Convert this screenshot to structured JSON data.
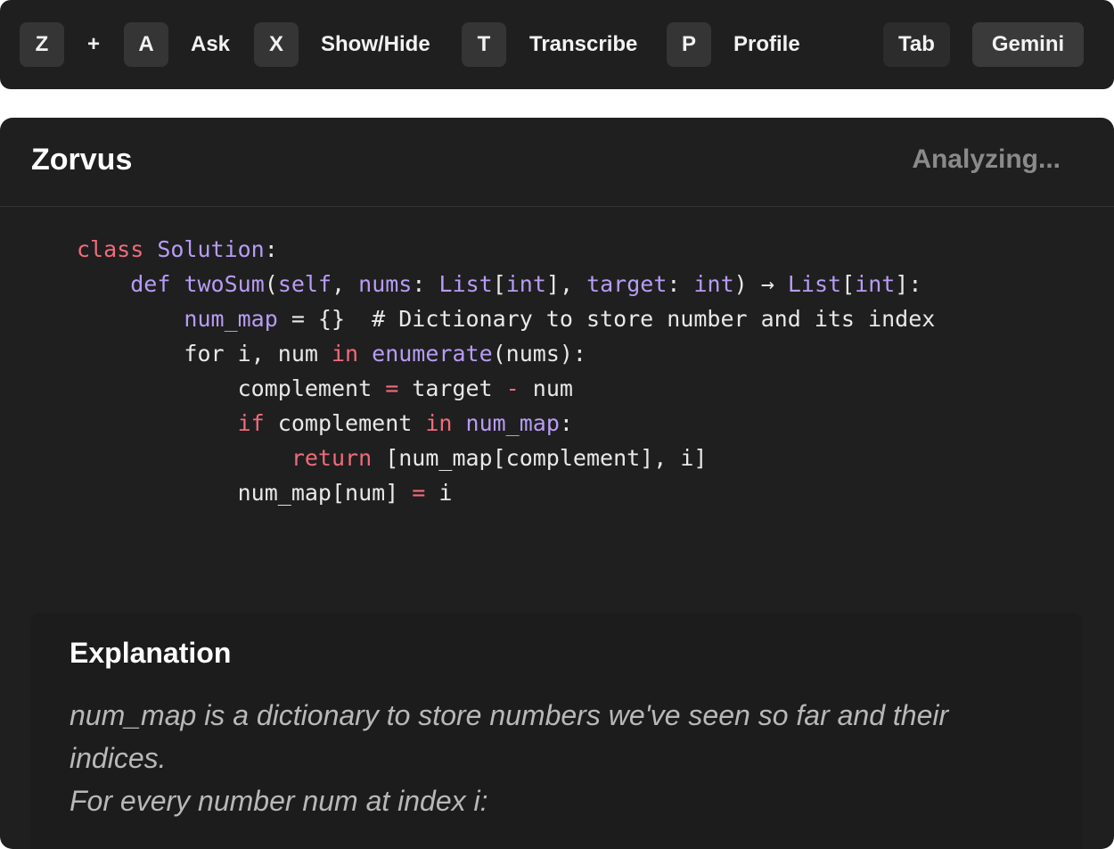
{
  "toolbar": {
    "keys": [
      {
        "key": "Z"
      },
      {
        "sep": "+"
      },
      {
        "key": "A",
        "label": "Ask"
      },
      {
        "key": "X",
        "label": "Show/Hide"
      },
      {
        "key": "T",
        "label": "Transcribe"
      },
      {
        "key": "P",
        "label": "Profile"
      }
    ],
    "z_key": "Z",
    "plus": "+",
    "ask_key": "A",
    "ask_label": "Ask",
    "showhide_key": "X",
    "showhide_label": "Show/Hide",
    "transcribe_key": "T",
    "transcribe_label": "Transcribe",
    "profile_key": "P",
    "profile_label": "Profile",
    "tab_label": "Tab",
    "model_label": "Gemini"
  },
  "panel": {
    "title": "Zorvus",
    "status": "Analyzing..."
  },
  "code": {
    "lines": [
      [
        [
          "k",
          "class"
        ],
        [
          "n",
          " "
        ],
        [
          "p",
          "Solution"
        ],
        [
          "n",
          ":"
        ]
      ],
      [
        [
          "n",
          "    "
        ],
        [
          "p",
          "def"
        ],
        [
          "n",
          " "
        ],
        [
          "p",
          "twoSum"
        ],
        [
          "n",
          "("
        ],
        [
          "p",
          "self"
        ],
        [
          "n",
          ", "
        ],
        [
          "p",
          "nums"
        ],
        [
          "n",
          ": "
        ],
        [
          "p",
          "List"
        ],
        [
          "n",
          "["
        ],
        [
          "p",
          "int"
        ],
        [
          "n",
          "], "
        ],
        [
          "p",
          "target"
        ],
        [
          "n",
          ": "
        ],
        [
          "p",
          "int"
        ],
        [
          "n",
          ") → "
        ],
        [
          "p",
          "List"
        ],
        [
          "n",
          "["
        ],
        [
          "p",
          "int"
        ],
        [
          "n",
          "]:"
        ]
      ],
      [
        [
          "n",
          "        "
        ],
        [
          "p",
          "num_map"
        ],
        [
          "n",
          " = {}  # Dictionary to store number and its index"
        ]
      ],
      [
        [
          "n",
          "        for i, num "
        ],
        [
          "k",
          "in"
        ],
        [
          "n",
          " "
        ],
        [
          "p",
          "enumerate"
        ],
        [
          "n",
          "(nums):"
        ]
      ],
      [
        [
          "n",
          "            complement "
        ],
        [
          "k",
          "="
        ],
        [
          "n",
          " target "
        ],
        [
          "k",
          "-"
        ],
        [
          "n",
          " num"
        ]
      ],
      [
        [
          "n",
          "            "
        ],
        [
          "k",
          "if"
        ],
        [
          "n",
          " complement "
        ],
        [
          "k",
          "in"
        ],
        [
          "n",
          " "
        ],
        [
          "p",
          "num_map"
        ],
        [
          "n",
          ":"
        ]
      ],
      [
        [
          "n",
          "                "
        ],
        [
          "k",
          "return"
        ],
        [
          "n",
          " [num_map[complement], i]"
        ]
      ],
      [
        [
          "n",
          "            num_map[num] "
        ],
        [
          "k",
          "="
        ],
        [
          "n",
          " i"
        ]
      ]
    ]
  },
  "explanation": {
    "title": "Explanation",
    "lines": [
      "num_map is a dictionary to store numbers we've seen so far and their",
      "indices.",
      "For every number num at index i:"
    ]
  },
  "colors": {
    "background": "#1f1f1f",
    "keyword": "#f06b7b",
    "purple": "#b79cf5",
    "text": "#e8e8e8",
    "muted": "#8a8a8a"
  }
}
